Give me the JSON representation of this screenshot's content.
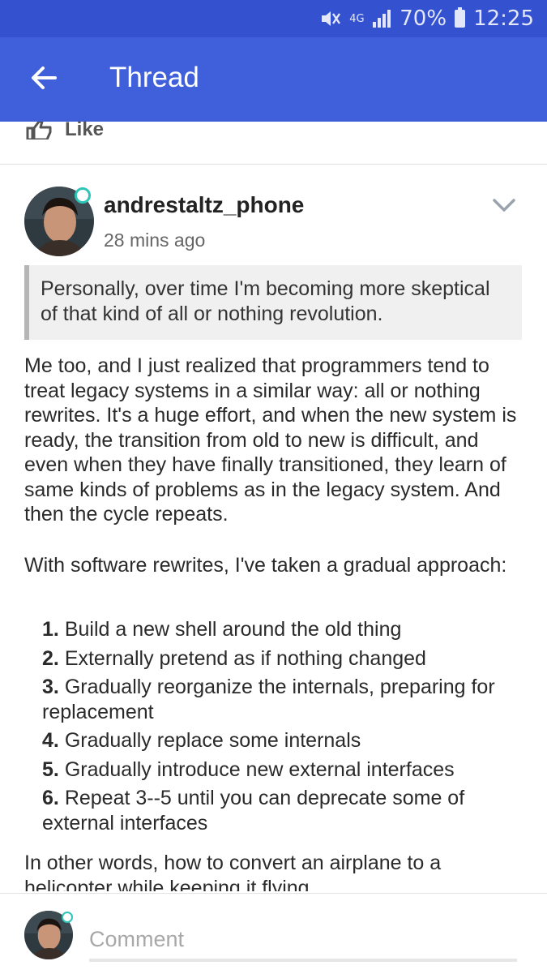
{
  "status_bar": {
    "battery_text": "70%",
    "time": "12:25",
    "network_label": "4G",
    "icons": [
      "mute-icon",
      "signal-icon",
      "battery-icon"
    ]
  },
  "app_bar": {
    "title": "Thread",
    "back_icon": "arrow-left-icon",
    "background": "#3f5fdb"
  },
  "previous_post": {
    "like_label": "Like"
  },
  "post": {
    "author": "andrestaltz_phone",
    "timestamp": "28 mins ago",
    "quote": "Personally, over time I'm becoming more skeptical of that kind of all or nothing revolution.",
    "paragraph_1": "Me too, and I just realized that programmers tend to treat legacy systems in a similar way: all or nothing rewrites. It's a huge effort, and when the new system is ready, the transition from old to new is difficult, and even when they have finally transitioned, they learn of same kinds of problems as in the legacy system. And then the cycle repeats.",
    "paragraph_2": "With software rewrites, I've taken a gradual approach:",
    "steps": [
      {
        "num": "1.",
        "text": "Build a new shell around the old thing"
      },
      {
        "num": "2.",
        "text": "Externally pretend as if nothing changed"
      },
      {
        "num": "3.",
        "text": "Gradually reorganize the internals, preparing for replacement"
      },
      {
        "num": "4.",
        "text": "Gradually replace some internals"
      },
      {
        "num": "5.",
        "text": "Gradually introduce new external interfaces"
      },
      {
        "num": "6.",
        "text": "Repeat 3--5 until you can deprecate some of external interfaces"
      }
    ],
    "paragraph_3": "In other words, how to convert an airplane to a helicopter while keeping it flying."
  },
  "comment": {
    "placeholder": "Comment"
  }
}
